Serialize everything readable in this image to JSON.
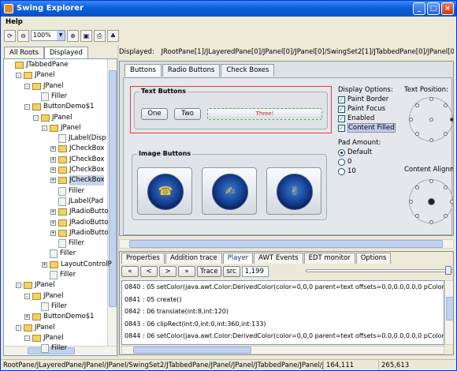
{
  "window": {
    "title": "Swing Explorer"
  },
  "menu": {
    "help": "Help"
  },
  "toolbar": {
    "zoom": "100%",
    "icons": [
      "refresh-icon",
      "zoom-out-icon",
      "zoom-in-icon",
      "fit-icon",
      "screenshot-icon",
      "tree-icon"
    ]
  },
  "left_tabs": [
    "All Roots",
    "Displayed"
  ],
  "tree": [
    {
      "label": "JTabbedPane",
      "depth": 0,
      "kind": "folder",
      "exp": ""
    },
    {
      "label": "JPanel",
      "depth": 1,
      "kind": "folder",
      "exp": "-"
    },
    {
      "label": "JPanel",
      "depth": 2,
      "kind": "folder",
      "exp": "-"
    },
    {
      "label": "Filler",
      "depth": 3,
      "kind": "leaf",
      "exp": ""
    },
    {
      "label": "ButtonDemo$1",
      "depth": 2,
      "kind": "folder",
      "exp": "-"
    },
    {
      "label": "JPanel",
      "depth": 3,
      "kind": "folder",
      "exp": "-"
    },
    {
      "label": "JPanel",
      "depth": 4,
      "kind": "folder",
      "exp": "-"
    },
    {
      "label": "JLabel(Disp",
      "depth": 5,
      "kind": "leaf",
      "exp": ""
    },
    {
      "label": "JCheckBox",
      "depth": 5,
      "kind": "folder",
      "exp": "+"
    },
    {
      "label": "JCheckBox",
      "depth": 5,
      "kind": "folder",
      "exp": "+"
    },
    {
      "label": "JCheckBox",
      "depth": 5,
      "kind": "folder",
      "exp": "+"
    },
    {
      "label": "JCheckBox",
      "depth": 5,
      "kind": "folder",
      "exp": "+",
      "selected": true
    },
    {
      "label": "Filler",
      "depth": 5,
      "kind": "leaf",
      "exp": ""
    },
    {
      "label": "JLabel(Pad",
      "depth": 5,
      "kind": "leaf",
      "exp": ""
    },
    {
      "label": "JRadioButto",
      "depth": 5,
      "kind": "folder",
      "exp": "+"
    },
    {
      "label": "JRadioButto",
      "depth": 5,
      "kind": "folder",
      "exp": "+"
    },
    {
      "label": "JRadioButto",
      "depth": 5,
      "kind": "folder",
      "exp": "+"
    },
    {
      "label": "Filler",
      "depth": 5,
      "kind": "leaf",
      "exp": ""
    },
    {
      "label": "Filler",
      "depth": 4,
      "kind": "leaf",
      "exp": ""
    },
    {
      "label": "LayoutControlP",
      "depth": 4,
      "kind": "folder",
      "exp": "+"
    },
    {
      "label": "Filler",
      "depth": 4,
      "kind": "leaf",
      "exp": ""
    },
    {
      "label": "JPanel",
      "depth": 1,
      "kind": "folder",
      "exp": "-"
    },
    {
      "label": "JPanel",
      "depth": 2,
      "kind": "folder",
      "exp": "-"
    },
    {
      "label": "Filler",
      "depth": 3,
      "kind": "leaf",
      "exp": ""
    },
    {
      "label": "ButtonDemo$1",
      "depth": 2,
      "kind": "folder",
      "exp": "+"
    },
    {
      "label": "JPanel",
      "depth": 1,
      "kind": "folder",
      "exp": "-"
    },
    {
      "label": "JPanel",
      "depth": 2,
      "kind": "folder",
      "exp": "-"
    },
    {
      "label": "Filler",
      "depth": 3,
      "kind": "leaf",
      "exp": ""
    }
  ],
  "displayed": {
    "label": "Displayed:",
    "path": "JRootPane[1]/JLayeredPane[0]/JPanel[0]/JPanel[0]/SwingSet2[1]/JTabbedPane[0]/JPanel[0]/JPanel[0]/JPane"
  },
  "demo_tabs": [
    "Buttons",
    "Radio Buttons",
    "Check Boxes"
  ],
  "text_buttons": {
    "title": "Text Buttons",
    "b1": "One",
    "b2": "Two",
    "b3": "Three!"
  },
  "image_buttons": {
    "title": "Image Buttons",
    "icons": [
      "phone-icon",
      "pen-icon",
      "peace-icon"
    ]
  },
  "display_options": {
    "title": "Display Options:",
    "items": [
      {
        "label": "Paint Border",
        "checked": true
      },
      {
        "label": "Paint Focus",
        "checked": true
      },
      {
        "label": "Enabled",
        "checked": true
      },
      {
        "label": "Content Filled",
        "checked": true,
        "highlight": true
      }
    ]
  },
  "pad_amount": {
    "title": "Pad Amount:",
    "items": [
      {
        "label": "Default",
        "on": true
      },
      {
        "label": "0",
        "on": false
      },
      {
        "label": "10",
        "on": false
      }
    ]
  },
  "text_position": {
    "title": "Text Position:"
  },
  "content_alignment": {
    "title": "Content Alignme"
  },
  "bottom_tabs": [
    "Properties",
    "Addition trace",
    "Player",
    "AWT Events",
    "EDT monitor",
    "Options"
  ],
  "player": {
    "buttons": [
      "«",
      "<",
      ">",
      "»"
    ],
    "trace": "Trace",
    "src": "src",
    "counter": "1,199"
  },
  "log": [
    "0840 : 05 setColor(java.awt.Color:DerivedColor(color=0,0,0 parent=text offsets=0.0,0.0,0.0,0 pColor=0,0,0",
    "0841 : 05 create()",
    "0842 : 06 translate(int:8,int:120)",
    "0843 : 06 clipRect(int:0,int:0,int:360,int:133)",
    "0844 : 06 setColor(java.awt.Color:DerivedColor(color=0,0,0 parent=text offsets=0.0,0.0,0.0,0 pColor=0,0,0",
    "0845 : 06 setFont(java.awt.Font:javax.swing.plaf.FontUIResource[family=SansSerif,name=sansserif,style=pla"
  ],
  "status": {
    "path": "RootPane/JLayeredPane/JPanel/JPanel/SwingSet2/JTabbedPane/JPanel/JPanel/JTabbedPane/JPanel/JPanel/JPanel",
    "coord1": "164,111",
    "coord2": "265,613"
  }
}
